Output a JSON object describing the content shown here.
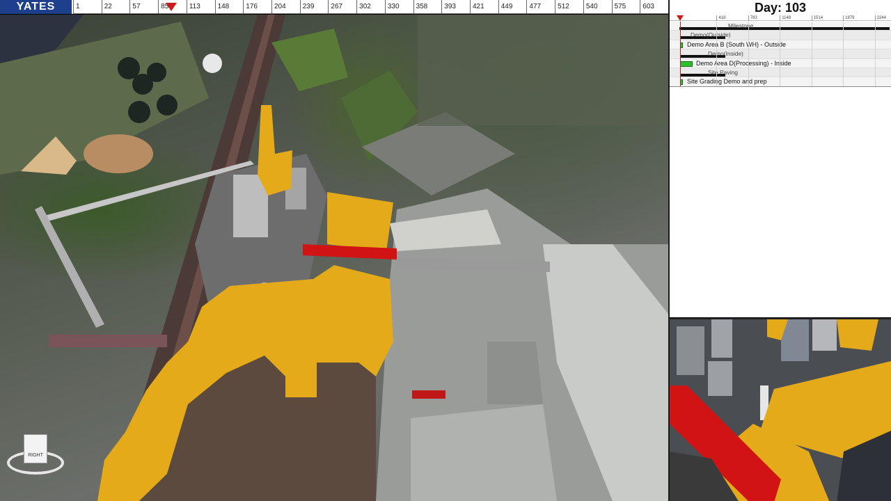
{
  "app": {
    "logo_text": "YATES"
  },
  "timeline": {
    "ticks": [
      "1",
      "22",
      "57",
      "85",
      "113",
      "148",
      "176",
      "204",
      "239",
      "267",
      "302",
      "330",
      "358",
      "393",
      "421",
      "449",
      "477",
      "512",
      "540",
      "575",
      "603"
    ],
    "marker_label": "current-day-marker"
  },
  "gantt": {
    "day_label": "Day: 103",
    "scale_ticks": [
      "418",
      "783",
      "1148",
      "1514",
      "1879",
      "2244"
    ],
    "rows": [
      {
        "type": "group",
        "label": "Milestone"
      },
      {
        "type": "group",
        "label": "Demo(Outside)"
      },
      {
        "type": "task",
        "label": "Demo Area B (South WH) - Outside"
      },
      {
        "type": "group",
        "label": "Demo(Inside)"
      },
      {
        "type": "task",
        "label": "Demo Area D(Processing) - Inside"
      },
      {
        "type": "group",
        "label": "Site Paving"
      },
      {
        "type": "task",
        "label": "Site Grading Demo and prep"
      }
    ]
  },
  "navcube": {
    "face_label": "RIGHT"
  },
  "colors": {
    "logo_bg": "#1d3f8c",
    "marker": "#cc1a1a",
    "demo_area_highlight": "#e4aa1a",
    "active_element": "#d11313",
    "task_bar": "#2ec02e"
  }
}
